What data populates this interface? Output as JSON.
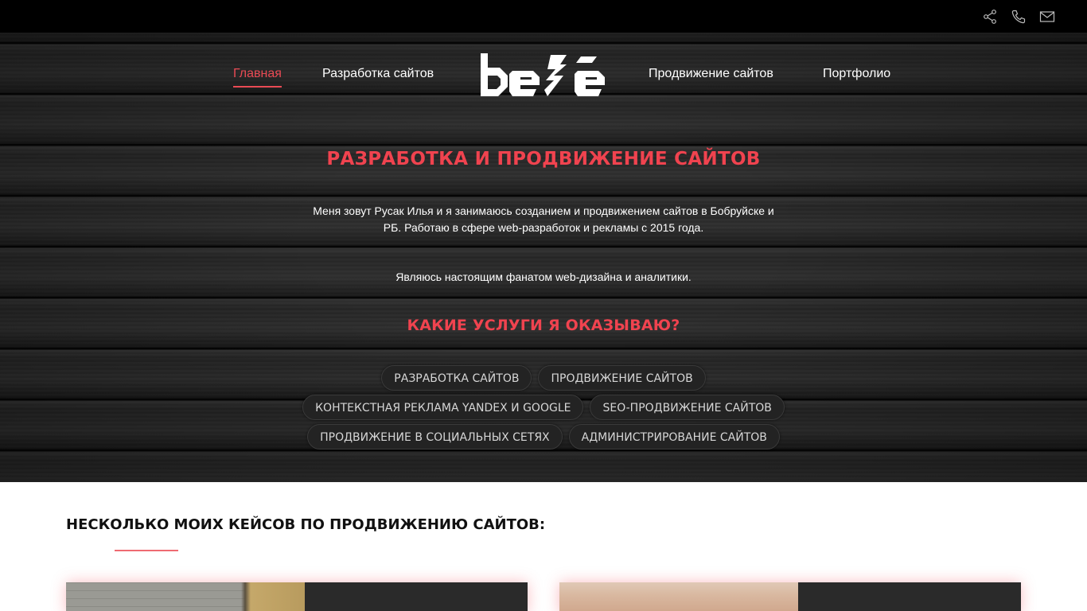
{
  "topbar": {
    "icons": [
      "share-icon",
      "phone-icon",
      "mail-icon"
    ]
  },
  "nav": {
    "items": [
      {
        "label": "Главная",
        "active": true
      },
      {
        "label": "Разработка сайтов",
        "active": false
      },
      {
        "label": "Продвижение сайтов",
        "active": false
      },
      {
        "label": "Портфолио",
        "active": false
      }
    ],
    "logo_text": "bele"
  },
  "hero": {
    "title": "РАЗРАБОТКА И ПРОДВИЖЕНИЕ САЙТОВ",
    "intro": "Меня зовут Русак Илья и я занимаюсь созданием и продвижением сайтов в Бобруйске и РБ. Работаю в сфере web-разработок и рекламы с 2015 года.",
    "intro2": "Являюсь настоящим фанатом web-дизайна и аналитики.",
    "services_title": "КАКИЕ УСЛУГИ Я ОКАЗЫВАЮ?",
    "services": [
      [
        "РАЗРАБОТКА САЙТОВ",
        "ПРОДВИЖЕНИЕ САЙТОВ"
      ],
      [
        "КОНТЕКСТНАЯ РЕКЛАМА YANDEX И GOOGLE",
        "SEO-ПРОДВИЖЕНИЕ САЙТОВ"
      ],
      [
        "ПРОДВИЖЕНИЕ В СОЦИАЛЬНЫХ СЕТЯХ",
        "АДМИНИСТРИРОВАНИЕ САЙТОВ"
      ]
    ]
  },
  "cases": {
    "title": "НЕСКОЛЬКО МОИХ КЕЙСОВ ПО ПРОДВИЖЕНИЮ САЙТОВ:"
  },
  "colors": {
    "accent": "#f0434f",
    "topbar": "#000000",
    "tag_bg": "#232323"
  }
}
